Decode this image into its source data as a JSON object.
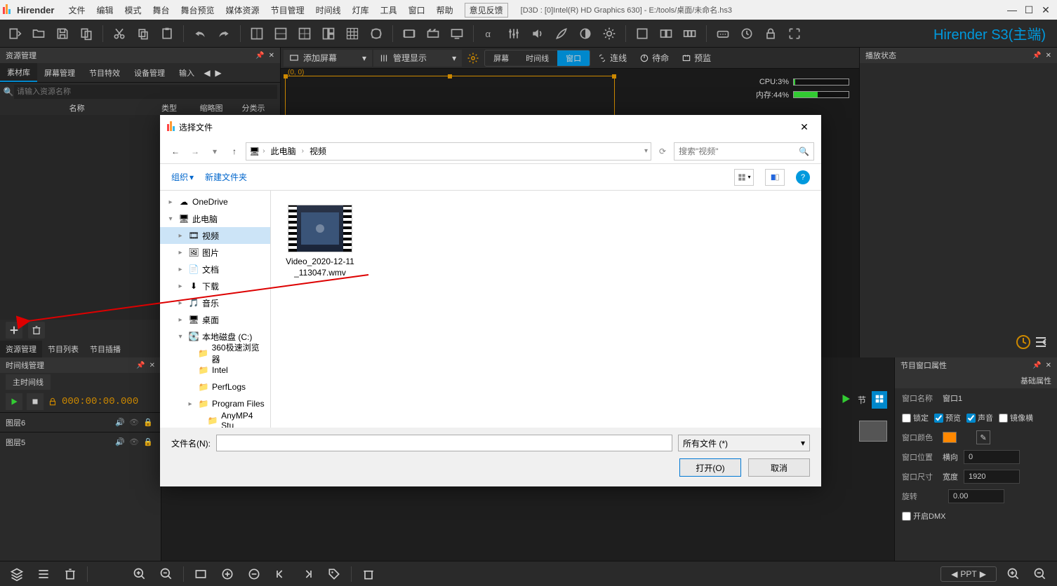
{
  "title_bar": {
    "app_name": "Hirender",
    "menus": [
      "文件",
      "编辑",
      "模式",
      "舞台",
      "舞台预览",
      "媒体资源",
      "节目管理",
      "时间线",
      "灯库",
      "工具",
      "窗口",
      "帮助"
    ],
    "feedback": "意见反馈",
    "doc_info": "[D3D : [0]Intel(R) HD Graphics 630] - E:/tools/桌面/未命名.hs3"
  },
  "toolbar": {
    "brand": "Hirender S3(主端)"
  },
  "left_panel": {
    "title": "资源管理",
    "tabs": [
      "素材库",
      "屏幕管理",
      "节目特效",
      "设备管理",
      "输入"
    ],
    "search_placeholder": "请输入资源名称",
    "columns": [
      "名称",
      "类型",
      "缩略图",
      "分类示"
    ],
    "lower_tabs": [
      "资源管理",
      "节目列表",
      "节目插播"
    ]
  },
  "center": {
    "add_screen": "添加屏幕",
    "manage_display": "管理显示",
    "segments": [
      "屏幕",
      "时间线",
      "窗口"
    ],
    "wire": "连线",
    "standby": "待命",
    "preview": "预监",
    "coord": "(0, 0)",
    "stats": {
      "cpu_label": "CPU:3%",
      "cpu_pct": 3,
      "mem_label": "内存:44%",
      "mem_pct": 44
    }
  },
  "right_panel": {
    "title": "播放状态"
  },
  "timeline": {
    "title": "时间线管理",
    "main": "主时间线",
    "tc": "000:00:00.000",
    "layers": [
      "图层6",
      "图层5"
    ],
    "cue": "节"
  },
  "props": {
    "title": "节目窗口属性",
    "section": "基础属性",
    "window_name_label": "窗口名称",
    "window_name": "窗口1",
    "lock": "锁定",
    "preview": "预览",
    "sound": "声音",
    "mirror": "镜像横",
    "color_label": "窗口颜色",
    "color": "#ff8800",
    "pos_label": "窗口位置",
    "pos_dir": "横向",
    "pos_val": "0",
    "size_label": "窗口尺寸",
    "size_dir": "宽度",
    "size_val": "1920",
    "rotate_label": "旋转",
    "rotate_val": "0.00",
    "dmx_label": "开启DMX"
  },
  "bottom_bar": {
    "ppt": "PPT"
  },
  "dialog": {
    "title": "选择文件",
    "crumbs": [
      "此电脑",
      "视频"
    ],
    "search_ph": "搜索\"视频\"",
    "organize": "组织",
    "new_folder": "新建文件夹",
    "tree": [
      {
        "label": "OneDrive",
        "icon": "cloud",
        "indent": 0,
        "caret": ">"
      },
      {
        "label": "此电脑",
        "icon": "pc",
        "indent": 0,
        "caret": "v"
      },
      {
        "label": "视频",
        "icon": "video",
        "indent": 1,
        "caret": ">",
        "selected": true
      },
      {
        "label": "图片",
        "icon": "image",
        "indent": 1,
        "caret": ">"
      },
      {
        "label": "文档",
        "icon": "doc",
        "indent": 1,
        "caret": ">"
      },
      {
        "label": "下载",
        "icon": "download",
        "indent": 1,
        "caret": ">"
      },
      {
        "label": "音乐",
        "icon": "music",
        "indent": 1,
        "caret": ">"
      },
      {
        "label": "桌面",
        "icon": "desktop",
        "indent": 1,
        "caret": ">"
      },
      {
        "label": "本地磁盘 (C:)",
        "icon": "disk",
        "indent": 1,
        "caret": "v"
      },
      {
        "label": "360极速浏览器",
        "icon": "folder",
        "indent": 2,
        "caret": ""
      },
      {
        "label": "Intel",
        "icon": "folder",
        "indent": 2,
        "caret": ""
      },
      {
        "label": "PerfLogs",
        "icon": "folder",
        "indent": 2,
        "caret": ""
      },
      {
        "label": "Program Files",
        "icon": "folder",
        "indent": 2,
        "caret": ">"
      },
      {
        "label": "AnyMP4 Stu",
        "icon": "folder",
        "indent": 3,
        "caret": ""
      }
    ],
    "file_name": "Video_2020-12-11_113047.wmv",
    "filename_label": "文件名(N):",
    "filter": "所有文件 (*)",
    "open": "打开(O)",
    "cancel": "取消"
  }
}
